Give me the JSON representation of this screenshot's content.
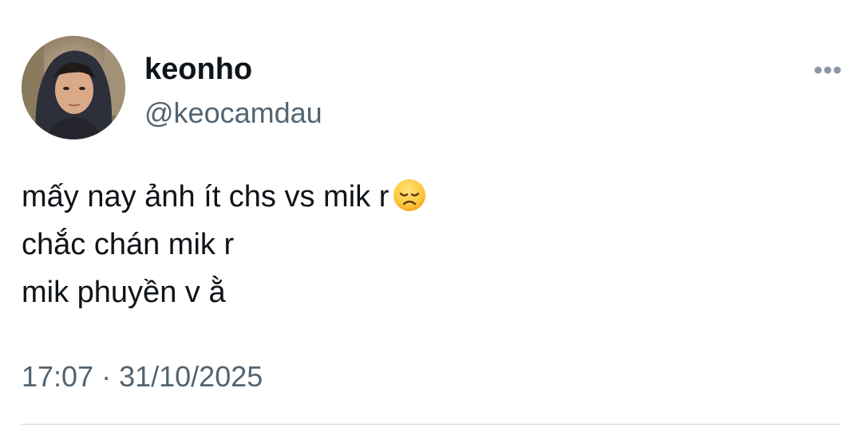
{
  "author": {
    "display_name": "keonho",
    "handle": "@keocamdau",
    "avatar_icon": "profile-photo"
  },
  "tweet": {
    "lines": [
      "mấy nay ảnh ít chs vs mik r",
      "chắc chán mik r",
      "mik phuyền v ằ"
    ],
    "emoji": "disappointed-face",
    "timestamp": "17:07 · 31/10/2025"
  },
  "icons": {
    "more": "more-horizontal-icon"
  },
  "colors": {
    "text_primary": "#0f1419",
    "text_secondary": "#536471",
    "divider": "#cfd9de",
    "background": "#ffffff"
  }
}
